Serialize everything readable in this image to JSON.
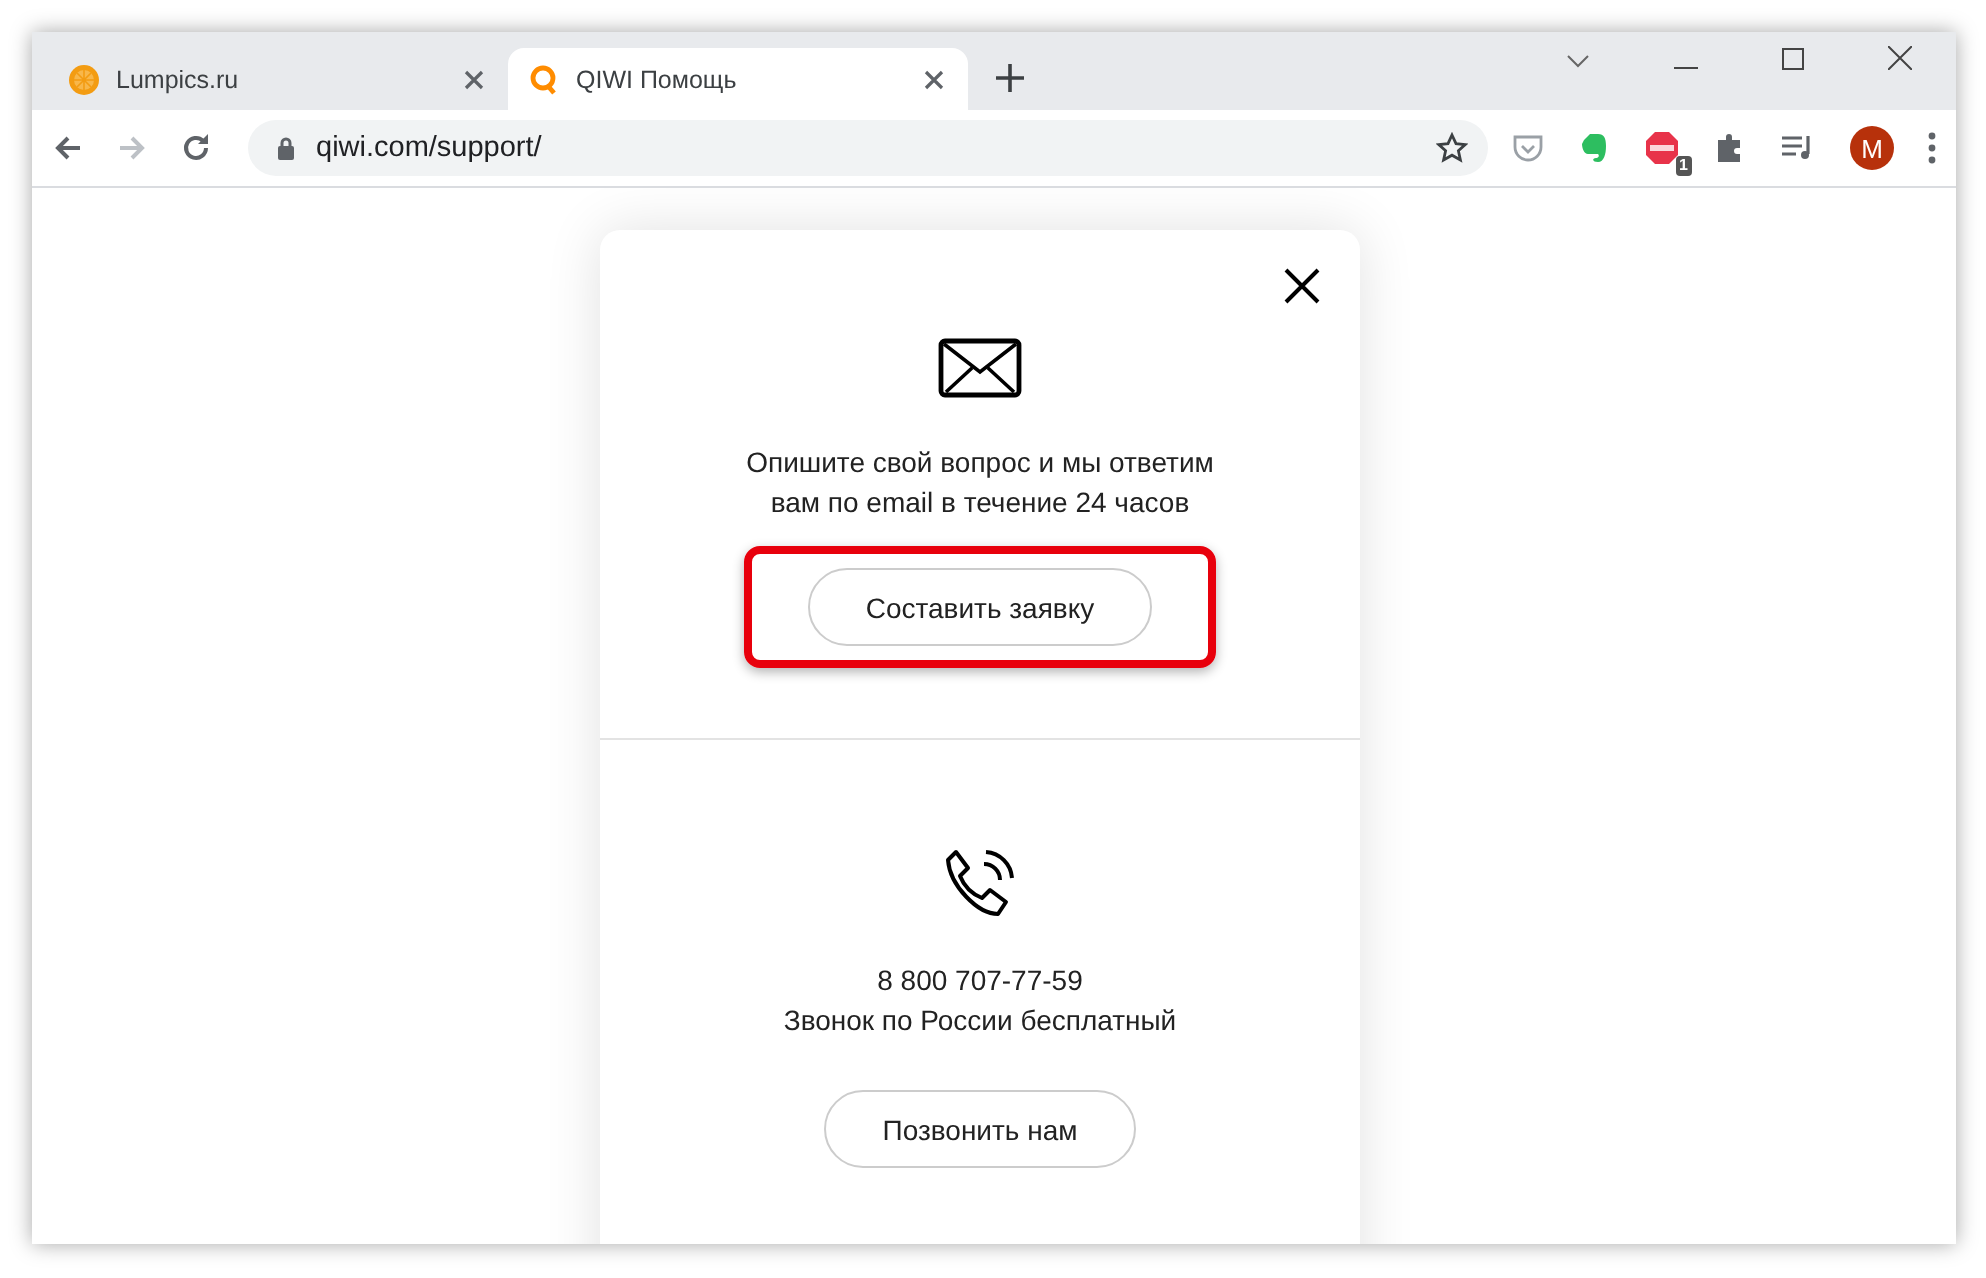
{
  "tabs": [
    {
      "title": "Lumpics.ru",
      "selected": false
    },
    {
      "title": "QIWI Помощь",
      "selected": true
    }
  ],
  "address": {
    "url": "qiwi.com/support/"
  },
  "extensions": {
    "abp_badge": "1",
    "avatar": "M"
  },
  "modal": {
    "sections": [
      {
        "kind": "email",
        "text": "Опишите свой вопрос и мы ответим\nвам по email в течение 24 часов",
        "button": "Составить заявку",
        "highlighted": true
      },
      {
        "kind": "phone",
        "phone": "8 800 707-77-59",
        "text": "Звонок по России бесплатный",
        "button": "Позвонить нам",
        "highlighted": false
      }
    ]
  }
}
